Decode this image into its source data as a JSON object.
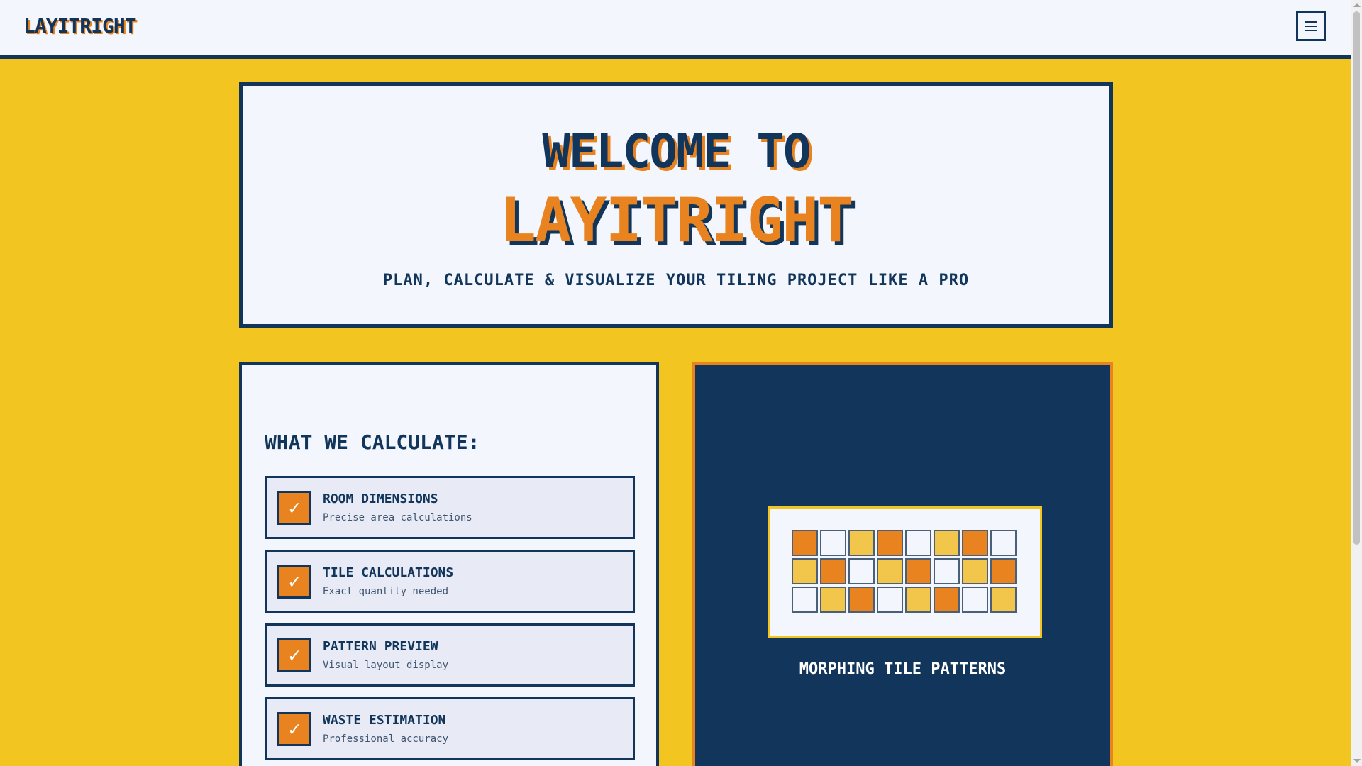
{
  "navbar": {
    "logo": "LAYITRIGHT",
    "menu_icon": "hamburger-menu-icon"
  },
  "hero": {
    "welcome": "WELCOME TO",
    "brand": "LAYITRIGHT",
    "tagline": "PLAN, CALCULATE & VISUALIZE YOUR TILING PROJECT LIKE A PRO"
  },
  "features": {
    "title": "WHAT WE CALCULATE:",
    "check_glyph": "✓",
    "items": [
      {
        "name": "ROOM DIMENSIONS",
        "desc": "Precise area calculations"
      },
      {
        "name": "TILE CALCULATIONS",
        "desc": "Exact quantity needed"
      },
      {
        "name": "PATTERN PREVIEW",
        "desc": "Visual layout display"
      },
      {
        "name": "WASTE ESTIMATION",
        "desc": "Professional accuracy"
      }
    ]
  },
  "patterns": {
    "label": "MORPHING TILE PATTERNS",
    "tile_rows": [
      [
        "orange",
        "white",
        "yellow",
        "orange",
        "white",
        "yellow",
        "orange",
        "white"
      ],
      [
        "yellow",
        "orange",
        "white",
        "yellow",
        "orange",
        "white",
        "yellow",
        "orange"
      ],
      [
        "white",
        "yellow",
        "orange",
        "white",
        "yellow",
        "orange",
        "white",
        "yellow"
      ]
    ]
  },
  "colors": {
    "navy": "#12365b",
    "orange": "#e8831f",
    "yellow": "#f3c520",
    "tile_yellow": "#f2c64a",
    "offwhite": "#f3f6fd"
  }
}
